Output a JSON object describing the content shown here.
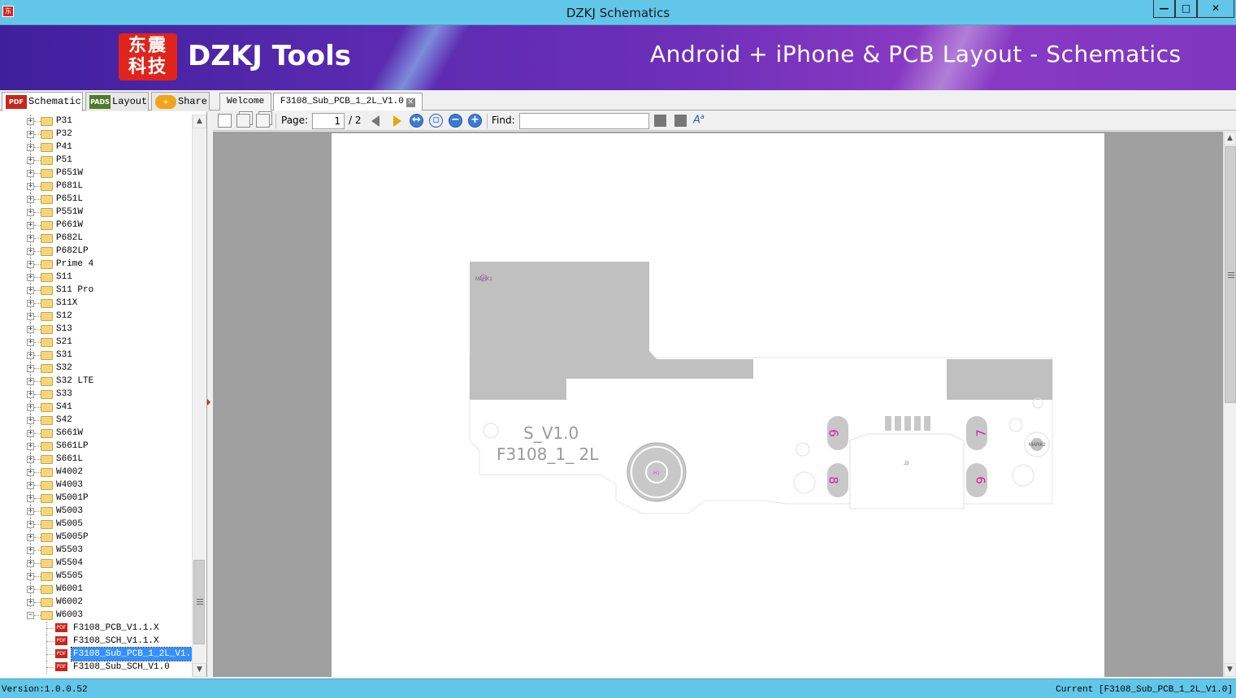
{
  "window": {
    "title": "DZKJ Schematics",
    "app_icon": "dzkj-app-icon",
    "minimize": "—",
    "maximize": "□",
    "close": "✕"
  },
  "banner": {
    "logo_text": "东震科技",
    "brand": "DZKJ Tools",
    "tagline": "Android + iPhone & PCB Layout - Schematics"
  },
  "left_tabs": [
    {
      "label": "Schematic",
      "icon": "PDF"
    },
    {
      "label": "Layout",
      "icon": "PADS"
    },
    {
      "label": "Share",
      "icon": "share-cloud-icon"
    }
  ],
  "doc_tabs": [
    {
      "label": "Welcome"
    },
    {
      "label": "F3108_Sub_PCB_1_2L_V1.0"
    }
  ],
  "tree": {
    "folders": [
      "P31",
      "P32",
      "P41",
      "P51",
      "P651W",
      "P681L",
      "P651L",
      "P551W",
      "P661W",
      "P682L",
      "P682LP",
      "Prime 4",
      "S11",
      "S11 Pro",
      "S11X",
      "S12",
      "S13",
      "S21",
      "S31",
      "S32",
      "S32 LTE",
      "S33",
      "S41",
      "S42",
      "S661W",
      "S661LP",
      "S661L",
      "W4002",
      "W4003",
      "W5001P",
      "W5003",
      "W5005",
      "W5005P",
      "W5503",
      "W5504",
      "W5505",
      "W6001",
      "W6002"
    ],
    "open_folder": "W6003",
    "files": [
      "F3108_PCB_V1.1.X",
      "F3108_SCH_V1.1.X",
      "F3108_Sub_PCB_1_2L_V1.0",
      "F3108_Sub_SCH_V1.0"
    ],
    "selected_file": "F3108_Sub_PCB_1_2L_V1.0",
    "pdf_icon_text": "PDF"
  },
  "toolbar": {
    "page_label": "Page:",
    "page_value": "1",
    "page_total": "/ 2",
    "find_label": "Find:",
    "find_value": ""
  },
  "pcb": {
    "mark1": "MARK1",
    "mark2": "MARK2",
    "silk1": "S_V1.0",
    "silk2": "F3108_1_ 2L",
    "pad_labels": [
      "6",
      "7",
      "8",
      "9"
    ],
    "connector": "J3",
    "hole": "H1"
  },
  "status": {
    "version": "Version:1.0.0.52",
    "current": "Current [F3108_Sub_PCB_1_2L_V1.0]"
  },
  "colors": {
    "titlebar": "#62c6e8",
    "banner_start": "#3f1f9c",
    "banner_end": "#8a3ac4",
    "pad_label": "#e01aa8",
    "board_gray": "#c0c0c0"
  }
}
